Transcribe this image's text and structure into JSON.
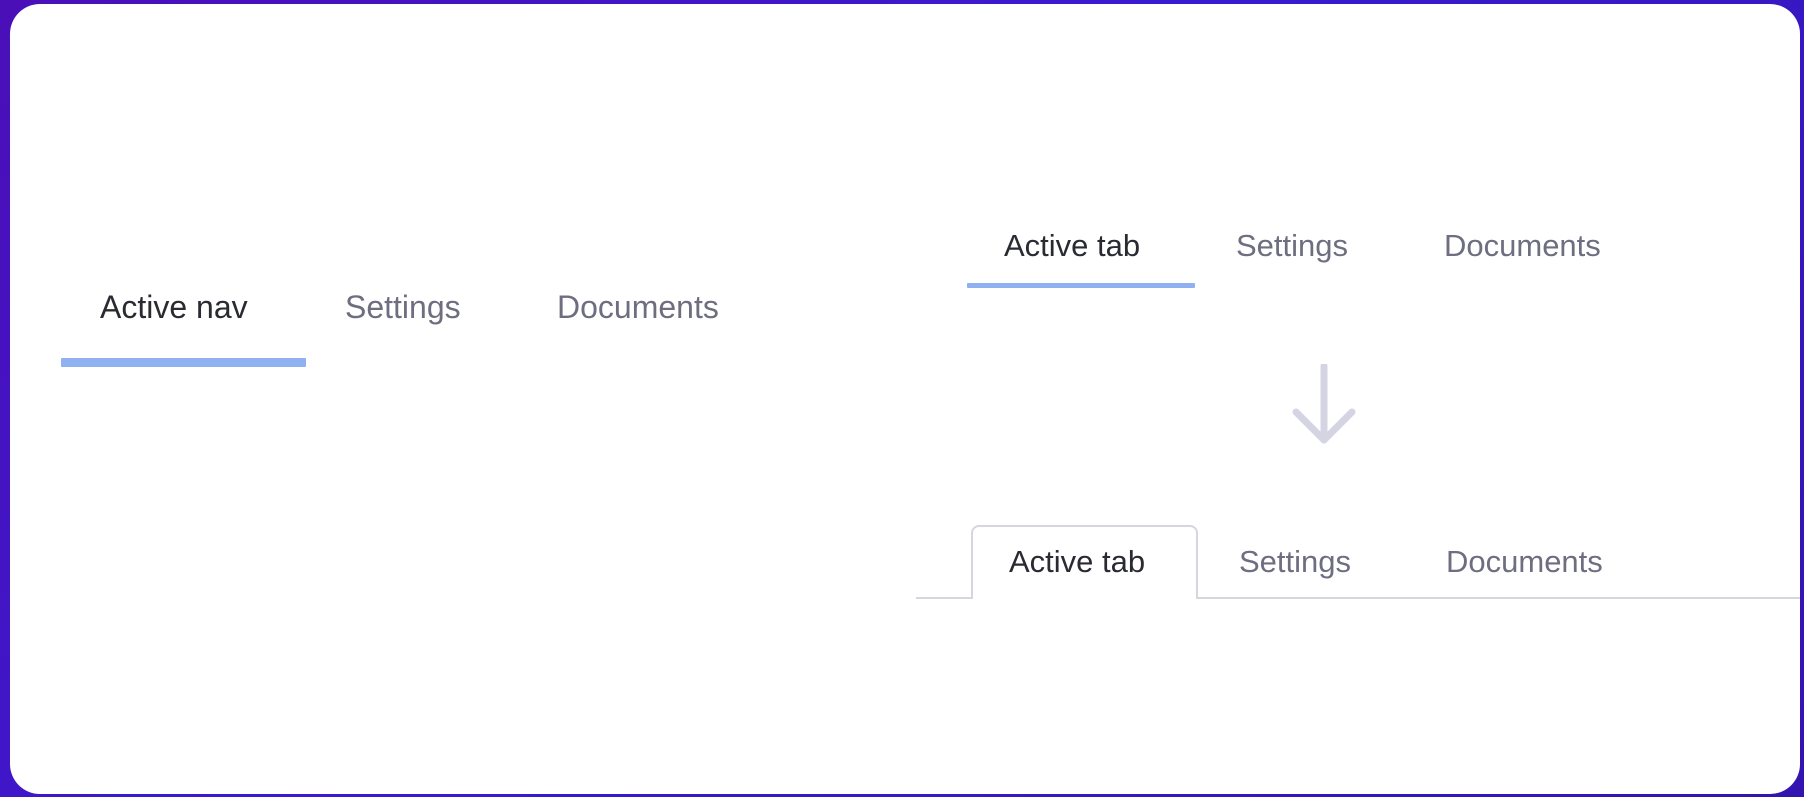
{
  "nav_example": {
    "items": [
      {
        "label": "Active nav",
        "active": true
      },
      {
        "label": "Settings",
        "active": false
      },
      {
        "label": "Documents",
        "active": false
      }
    ],
    "underline_color": "#8fb1f2"
  },
  "tabs_before": {
    "items": [
      {
        "label": "Active tab",
        "active": true
      },
      {
        "label": "Settings",
        "active": false
      },
      {
        "label": "Documents",
        "active": false
      }
    ],
    "underline_color": "#8fb1f2"
  },
  "transition_icon": "arrow-down-icon",
  "tabs_after": {
    "items": [
      {
        "label": "Active tab",
        "active": true
      },
      {
        "label": "Settings",
        "active": false
      },
      {
        "label": "Documents",
        "active": false
      }
    ],
    "border_color": "#d6d6de"
  },
  "colors": {
    "background_gradient_start": "#4b0fb8",
    "background_gradient_end": "#3314b0",
    "card": "#ffffff",
    "active_text": "#2a2a33",
    "inactive_text": "#6e6e80",
    "arrow": "#d4d4e2"
  }
}
